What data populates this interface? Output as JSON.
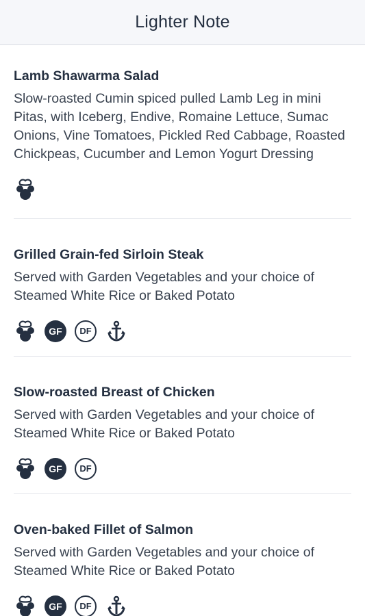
{
  "header": {
    "title": "Lighter Note"
  },
  "menu": {
    "items": [
      {
        "name": "Lamb Shawarma Salad",
        "description": "Slow-roasted Cumin spiced pulled Lamb Leg in mini Pitas, with Iceberg, Endive, Romaine Lettuce, Sumac Onions, Vine Tomatoes, Pickled Red Cabbage, Roasted Chickpeas, Cucumber and Lemon Yogurt Dressing",
        "icons": [
          "chef-mickey-icon"
        ]
      },
      {
        "name": "Grilled Grain-fed Sirloin Steak",
        "description": "Served with Garden Vegetables and your choice of Steamed White Rice or Baked Potato",
        "icons": [
          "chef-mickey-icon",
          "gf-badge",
          "df-badge",
          "anchor-icon"
        ]
      },
      {
        "name": "Slow-roasted Breast of Chicken",
        "description": "Served with Garden Vegetables and your choice of Steamed White Rice or Baked Potato",
        "icons": [
          "chef-mickey-icon",
          "gf-badge",
          "df-badge"
        ]
      },
      {
        "name": "Oven-baked Fillet of Salmon",
        "description": "Served with Garden Vegetables and your choice of Steamed White Rice or Baked Potato",
        "icons": [
          "chef-mickey-icon",
          "gf-badge",
          "df-badge",
          "anchor-icon"
        ]
      }
    ]
  },
  "badges": {
    "gf": "GF",
    "df": "DF"
  },
  "colors": {
    "text": "#253041",
    "header_bg": "#f6f7fa",
    "divider": "#e3e5ea"
  }
}
